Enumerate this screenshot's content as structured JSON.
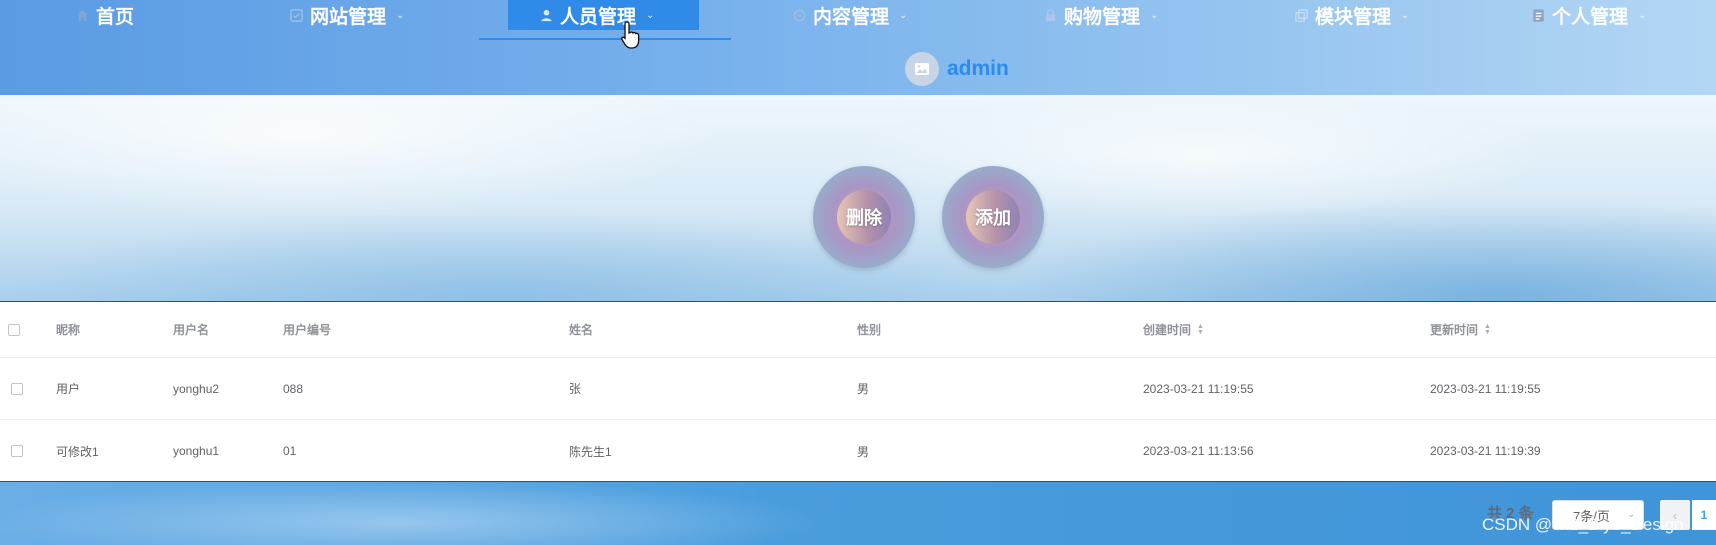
{
  "nav": {
    "items": [
      {
        "label": "首页",
        "icon": "home-icon",
        "has_dropdown": false
      },
      {
        "label": "网站管理",
        "icon": "website-icon",
        "has_dropdown": true
      },
      {
        "label": "人员管理",
        "icon": "user-icon",
        "has_dropdown": true,
        "active": true
      },
      {
        "label": "内容管理",
        "icon": "chat-icon",
        "has_dropdown": true
      },
      {
        "label": "购物管理",
        "icon": "lock-icon",
        "has_dropdown": true
      },
      {
        "label": "模块管理",
        "icon": "copy-icon",
        "has_dropdown": true
      },
      {
        "label": "个人管理",
        "icon": "document-icon",
        "has_dropdown": true
      }
    ],
    "caret": "⌄",
    "active_color": "#2f8ae8"
  },
  "user": {
    "name": "admin",
    "avatar_icon": "image-icon"
  },
  "actions": {
    "delete_label": "删除",
    "add_label": "添加"
  },
  "table": {
    "columns": [
      "昵称",
      "用户名",
      "用户编号",
      "姓名",
      "性别",
      "创建时间",
      "更新时间"
    ],
    "rows": [
      [
        "用户",
        "yonghu2",
        "088",
        "张",
        "男",
        "2023-03-21 11:19:55",
        "2023-03-21 11:19:55"
      ],
      [
        "可修改1",
        "yonghu1",
        "01",
        "陈先生1",
        "男",
        "2023-03-21 11:13:56",
        "2023-03-21 11:19:39"
      ]
    ]
  },
  "pagination": {
    "total_text": "共 2 条",
    "page_size_text": "7条/页",
    "current_page": "1",
    "prev_symbol": "‹",
    "dropdown_symbol": "⌄"
  },
  "watermark": "CSDN @vx2_Biye_Design",
  "colors": {
    "accent": "#409eff",
    "username": "#2b8cf0"
  }
}
